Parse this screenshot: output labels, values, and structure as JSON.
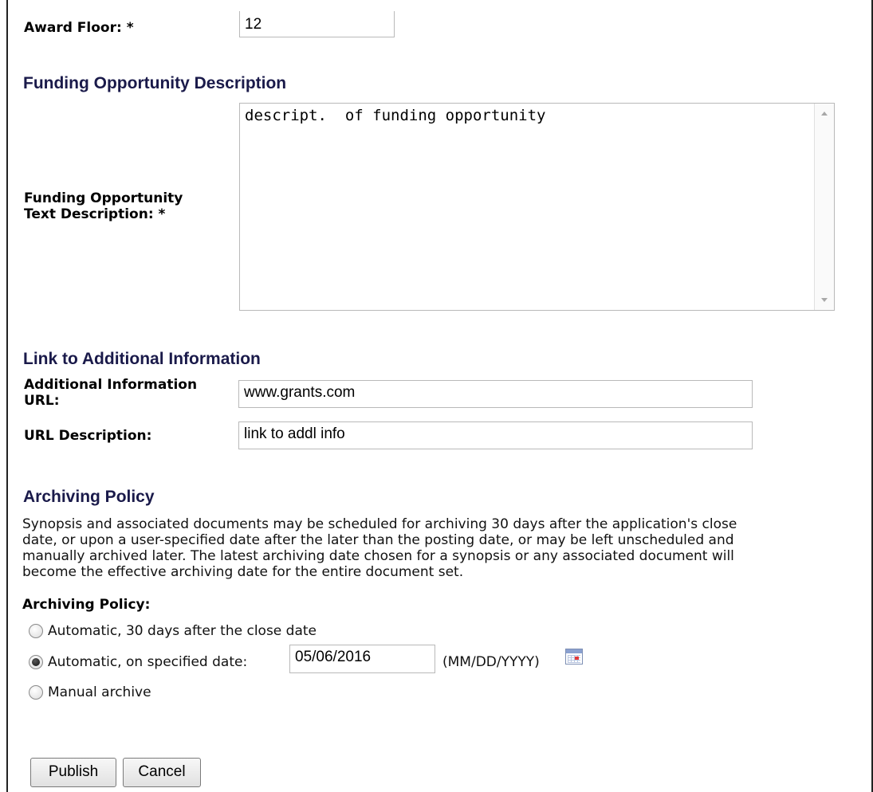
{
  "award_floor": {
    "label": "Award Floor: *",
    "value": "12"
  },
  "funding_description": {
    "heading": "Funding Opportunity Description",
    "label_line1": "Funding Opportunity",
    "label_line2": "Text Description: *",
    "value": "descript.  of funding opportunity"
  },
  "additional_info": {
    "heading": "Link to Additional Information",
    "url_label_line1": "Additional Information",
    "url_label_line2": "URL:",
    "url_value": "www.grants.com",
    "desc_label": "URL Description:",
    "desc_value": "link to addl info"
  },
  "archiving": {
    "heading": "Archiving Policy",
    "paragraph_lines": [
      "Synopsis and associated documents may be scheduled for archiving 30 days after the application's close",
      "date, or upon a user-specified date after the later than the posting date, or may be left unscheduled and",
      "manually archived later. The latest archiving date chosen for a synopsis or any associated document will",
      "become the effective archiving date for the entire document set."
    ],
    "policy_label": "Archiving Policy:",
    "options": [
      {
        "label": "Automatic, 30 days after the close date",
        "selected": false
      },
      {
        "label": "Automatic, on specified date:",
        "selected": true
      },
      {
        "label": "Manual archive",
        "selected": false
      }
    ],
    "date_value": "05/06/2016",
    "date_format_hint": "(MM/DD/YYYY)",
    "calendar_icon": "calendar-icon"
  },
  "buttons": {
    "publish": "Publish",
    "cancel": "Cancel"
  },
  "colors": {
    "heading": "#1a1a4a",
    "border": "#b9b9b9"
  }
}
